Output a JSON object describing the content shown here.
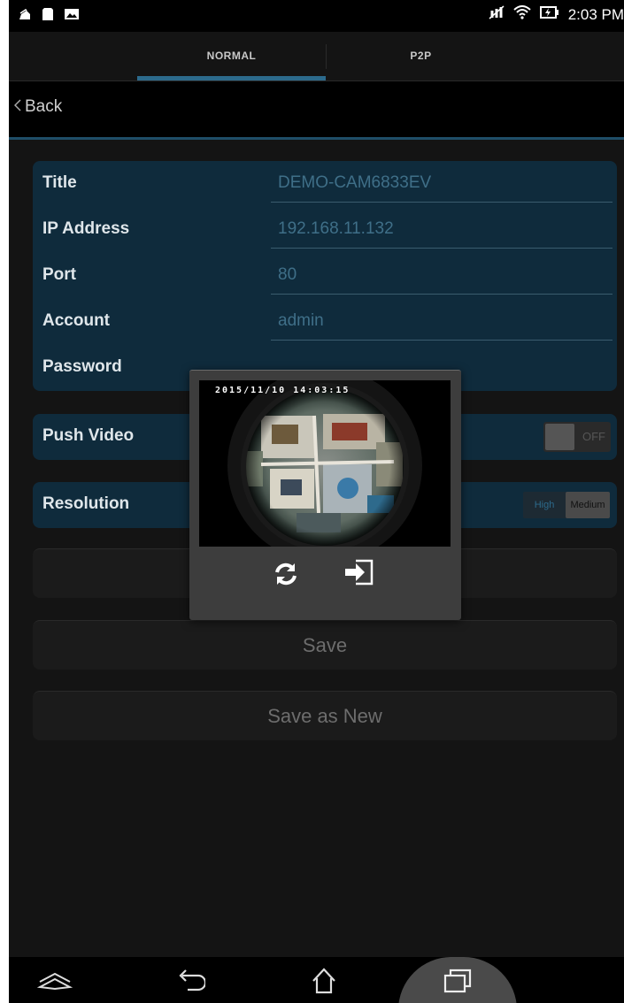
{
  "status_bar": {
    "time": "2:03 PM",
    "left_icons": [
      "notification-icon",
      "sd-card-icon",
      "image-icon"
    ],
    "right_icons": [
      "data-off-icon",
      "wifi-icon",
      "battery-charging-icon"
    ]
  },
  "tabs": [
    {
      "label": "NORMAL",
      "selected": true
    },
    {
      "label": "P2P",
      "selected": false
    }
  ],
  "header": {
    "back_label": "Back"
  },
  "form": {
    "rows": [
      {
        "label": "Title",
        "value": "DEMO-CAM6833EV"
      },
      {
        "label": "IP Address",
        "value": "192.168.11.132"
      },
      {
        "label": "Port",
        "value": "80"
      },
      {
        "label": "Account",
        "value": "admin"
      },
      {
        "label": "Password",
        "value": ""
      }
    ]
  },
  "push_video": {
    "label": "Push Video",
    "toggle_text": "OFF",
    "enabled": false
  },
  "resolution": {
    "label": "Resolution",
    "options": [
      "High",
      "Medium"
    ],
    "selected": "Medium"
  },
  "buttons": {
    "save": "Save",
    "save_as_new": "Save as New"
  },
  "popup": {
    "timestamp": "2015/11/10 14:03:15",
    "icons": [
      "refresh-icon",
      "exit-icon"
    ]
  },
  "nav_bar": {
    "icons": [
      "menu-icon",
      "back-icon",
      "home-icon",
      "recent-apps-icon"
    ]
  },
  "colors": {
    "accent": "#2c6a8c",
    "card": "#0f2b3c",
    "background": "#141414"
  }
}
